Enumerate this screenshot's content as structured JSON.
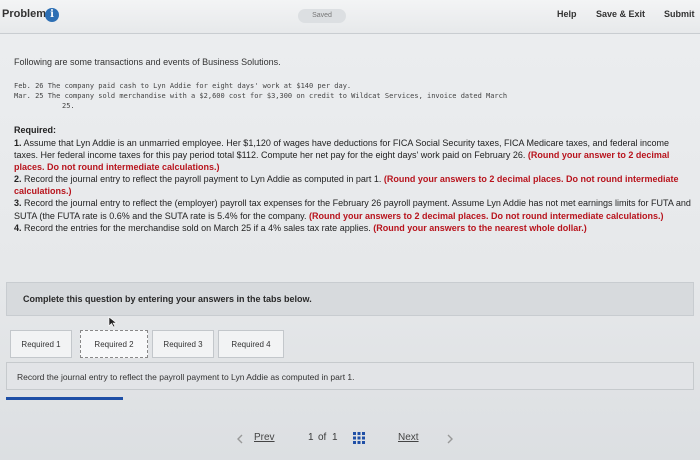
{
  "header": {
    "problem_label": "Problem",
    "info_glyph": "i",
    "saved_label": "Saved",
    "help_label": "Help",
    "save_exit_label": "Save & Exit",
    "submit_label": "Submit"
  },
  "intro": "Following are some transactions and events of Business Solutions.",
  "transactions": [
    "Feb. 26 The company paid cash to Lyn Addie for eight days' work at $140 per day.",
    "Mar. 25 The company sold merchandise with a $2,600 cost for $3,300 on credit to Wildcat Services, invoice dated March",
    "25."
  ],
  "required": {
    "title": "Required:",
    "items": [
      {
        "num": "1.",
        "text": "Assume that Lyn Addie is an unmarried employee. Her $1,120 of wages have deductions for FICA Social Security taxes, FICA Medicare taxes, and federal income taxes. Her federal income taxes for this pay period total $112. Compute her net pay for the eight days' work paid on February 26.",
        "note": "(Round your answer to 2 decimal places. Do not round intermediate calculations.)"
      },
      {
        "num": "2.",
        "text": "Record the journal entry to reflect the payroll payment to Lyn Addie as computed in part 1.",
        "note": "(Round your answers to 2 decimal places. Do not round intermediate calculations.)"
      },
      {
        "num": "3.",
        "text": "Record the journal entry to reflect the (employer) payroll tax expenses for the February 26 payroll payment. Assume Lyn Addie has not met earnings limits for FUTA and SUTA (the FUTA rate is 0.6% and the SUTA rate is 5.4% for the company.",
        "note": "(Round your answers to 2 decimal places. Do not round intermediate calculations.)"
      },
      {
        "num": "4.",
        "text": "Record the entries for the merchandise sold on March 25 if a 4% sales tax rate applies.",
        "note": "(Round your answers to the nearest whole dollar.)"
      }
    ]
  },
  "panel_text": "Complete this question by entering your answers in the tabs below.",
  "tabs": [
    {
      "label": "Required 1"
    },
    {
      "label": "Required 2"
    },
    {
      "label": "Required 3"
    },
    {
      "label": "Required 4"
    }
  ],
  "active_tab": "Required 2",
  "instruction": "Record the journal entry to reflect the payroll payment to Lyn Addie as computed in part 1.",
  "progress_fraction": 0.17,
  "pager": {
    "prev_label": "Prev",
    "page_current": "1",
    "of_word": "of",
    "page_total": "1",
    "next_label": "Next"
  },
  "colors": {
    "accent": "#1f4fa6",
    "note_red": "#b8141d",
    "info_blue": "#2d6fb4"
  },
  "icons": [
    "info-icon",
    "grid-icon",
    "chevron-left-icon",
    "chevron-right-icon",
    "cursor-arrow-icon"
  ]
}
